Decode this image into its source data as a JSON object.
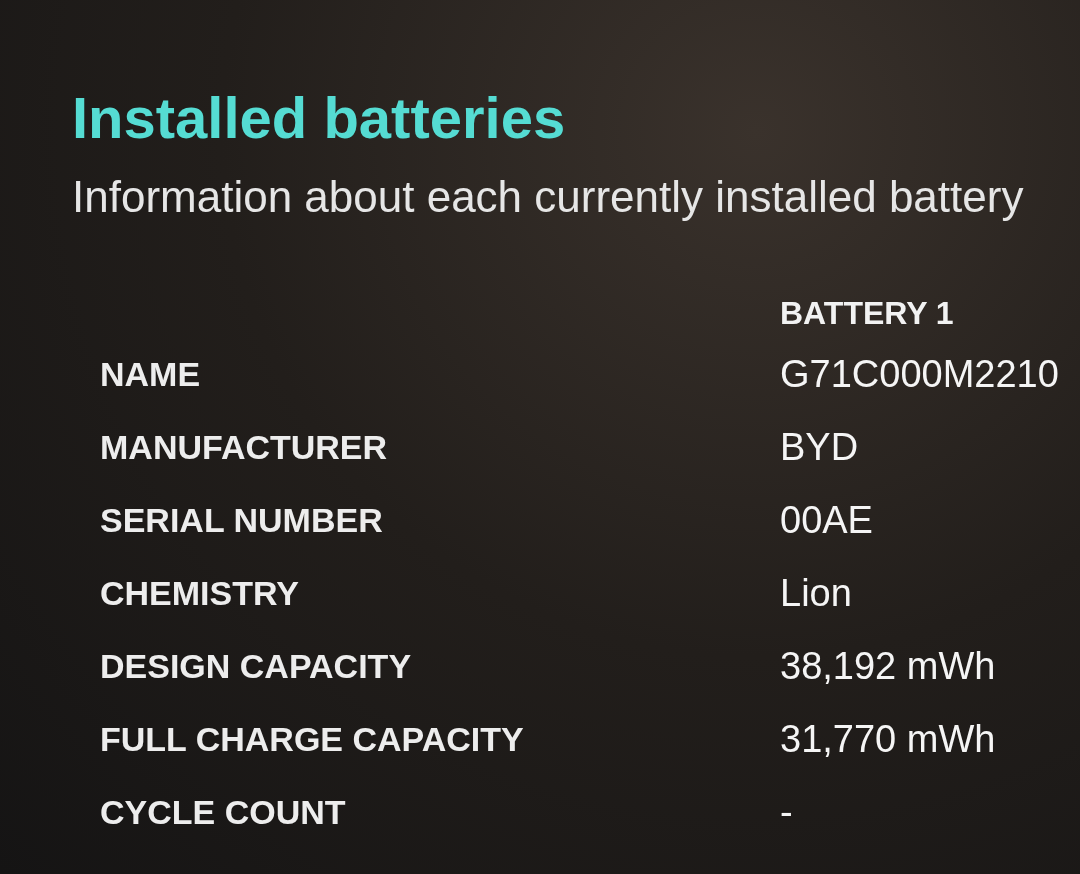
{
  "header": {
    "title": "Installed batteries",
    "subtitle": "Information about each currently installed battery"
  },
  "table": {
    "column_header": "BATTERY 1",
    "rows": [
      {
        "label": "NAME",
        "value": "G71C000M2210"
      },
      {
        "label": "MANUFACTURER",
        "value": "BYD"
      },
      {
        "label": "SERIAL NUMBER",
        "value": "00AE"
      },
      {
        "label": "CHEMISTRY",
        "value": "Lion"
      },
      {
        "label": "DESIGN CAPACITY",
        "value": "38,192 mWh"
      },
      {
        "label": "FULL CHARGE CAPACITY",
        "value": "31,770 mWh"
      },
      {
        "label": "CYCLE COUNT",
        "value": "-"
      }
    ]
  }
}
